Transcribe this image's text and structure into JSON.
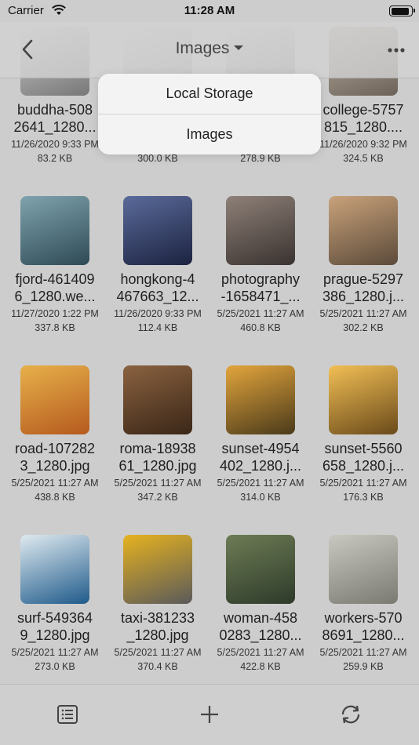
{
  "status_bar": {
    "carrier": "Carrier",
    "time": "11:28 AM"
  },
  "nav": {
    "title": "Images",
    "back_icon": "chevron-left-icon",
    "more_icon": "more-horizontal-icon"
  },
  "dropdown": {
    "items": [
      "Local Storage",
      "Images"
    ]
  },
  "files": [
    {
      "name": "buddha-508\n2641_1280...",
      "date": "11/26/2020 9:33 PM",
      "size": "83.2 KB",
      "colors": [
        "#777",
        "#cfcfcf"
      ]
    },
    {
      "name": "",
      "date": "",
      "size": "300.0 KB",
      "colors": [
        "#999",
        "#cfcfcf"
      ]
    },
    {
      "name": "",
      "date": "",
      "size": "278.9 KB",
      "colors": [
        "#8a8a8a",
        "#cfcfcf"
      ]
    },
    {
      "name": "college-5757\n815_1280....",
      "date": "11/26/2020 9:32 PM",
      "size": "324.5 KB",
      "colors": [
        "#6d6258",
        "#bdb3a6"
      ]
    },
    {
      "name": "fjord-461409\n6_1280.we...",
      "date": "11/27/2020 1:22 PM",
      "size": "337.8 KB",
      "colors": [
        "#2e4a55",
        "#7fa3ae"
      ]
    },
    {
      "name": "hongkong-4\n467663_12...",
      "date": "11/26/2020 9:33 PM",
      "size": "112.4 KB",
      "colors": [
        "#1c2340",
        "#5a6a9a"
      ]
    },
    {
      "name": "photography\n-1658471_...",
      "date": "5/25/2021 11:27 AM",
      "size": "460.8 KB",
      "colors": [
        "#3a3330",
        "#8e8078"
      ]
    },
    {
      "name": "prague-5297\n386_1280.j...",
      "date": "5/25/2021 11:27 AM",
      "size": "302.2 KB",
      "colors": [
        "#5b4a3a",
        "#c9a27a"
      ]
    },
    {
      "name": "road-107282\n3_1280.jpg",
      "date": "5/25/2021 11:27 AM",
      "size": "438.8 KB",
      "colors": [
        "#b55a1e",
        "#e7b04a"
      ]
    },
    {
      "name": "roma-18938\n61_1280.jpg",
      "date": "5/25/2021 11:27 AM",
      "size": "347.2 KB",
      "colors": [
        "#3a2617",
        "#8a6240"
      ]
    },
    {
      "name": "sunset-4954\n402_1280.j...",
      "date": "5/25/2021 11:27 AM",
      "size": "314.0 KB",
      "colors": [
        "#4a3a1a",
        "#e3a53c"
      ]
    },
    {
      "name": "sunset-5560\n658_1280.j...",
      "date": "5/25/2021 11:27 AM",
      "size": "176.3 KB",
      "colors": [
        "#6a4a1a",
        "#f2bf55"
      ]
    },
    {
      "name": "surf-549364\n9_1280.jpg",
      "date": "5/25/2021 11:27 AM",
      "size": "273.0 KB",
      "colors": [
        "#1f5a8a",
        "#dfeaf0"
      ]
    },
    {
      "name": "taxi-381233\n_1280.jpg",
      "date": "5/25/2021 11:27 AM",
      "size": "370.4 KB",
      "colors": [
        "#5a5a5a",
        "#e6b21f"
      ]
    },
    {
      "name": "woman-458\n0283_1280...",
      "date": "5/25/2021 11:27 AM",
      "size": "422.8 KB",
      "colors": [
        "#2e3a2a",
        "#6d7c55"
      ]
    },
    {
      "name": "workers-570\n8691_1280...",
      "date": "5/25/2021 11:27 AM",
      "size": "259.9 KB",
      "colors": [
        "#7a7a72",
        "#c8c8c0"
      ]
    }
  ],
  "toolbar": {
    "list_icon": "list-icon",
    "add_icon": "plus-icon",
    "refresh_icon": "refresh-icon"
  }
}
